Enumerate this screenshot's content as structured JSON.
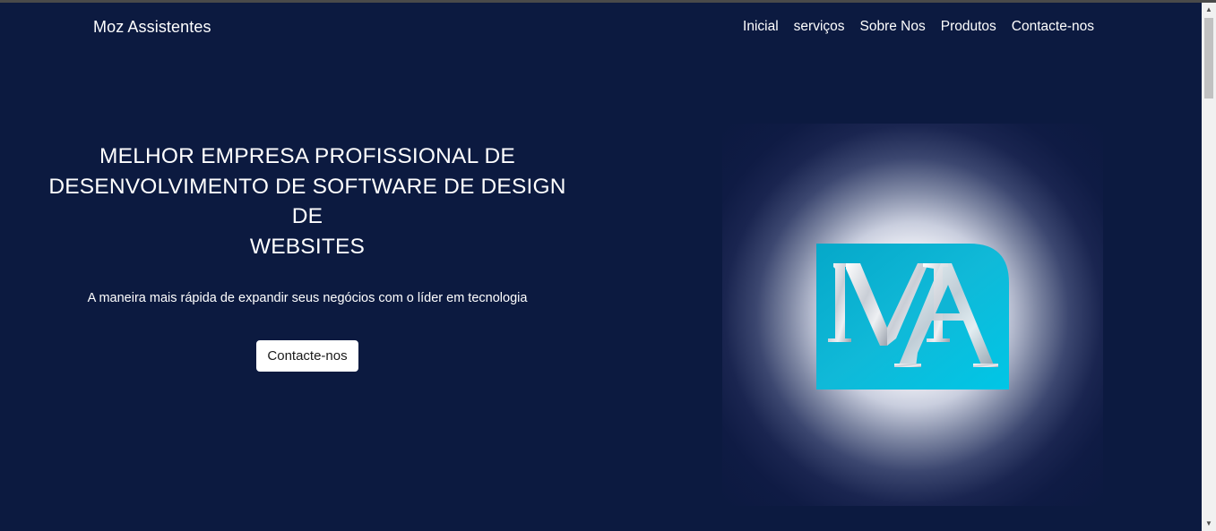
{
  "header": {
    "brand": "Moz Assistentes",
    "nav": [
      {
        "label": "Inicial"
      },
      {
        "label": "serviços"
      },
      {
        "label": "Sobre Nos"
      },
      {
        "label": "Produtos"
      },
      {
        "label": "Contacte-nos"
      }
    ]
  },
  "hero": {
    "title_lines": [
      "MELHOR EMPRESA PROFISSIONAL DE",
      "DESENVOLVIMENTO DE SOFTWARE DE DESIGN DE",
      "WEBSITES"
    ],
    "subtitle": "A maneira mais rápida de expandir seus negócios com o líder em tecnologia",
    "cta_label": "Contacte-nos"
  },
  "logo": {
    "monogram": "MA",
    "colors": {
      "tile": "#06b4d4",
      "letters": "#d9dde3"
    }
  },
  "scrollbar": {
    "up_icon": "▲",
    "down_icon": "▼"
  }
}
